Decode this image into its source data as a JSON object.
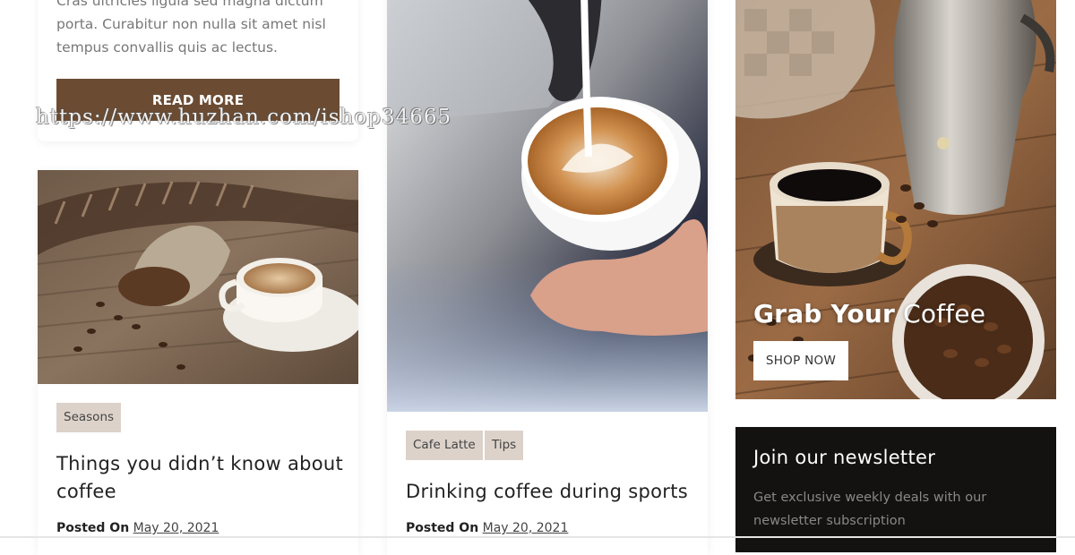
{
  "top_card": {
    "excerpt": "Cras ultricies ligula sed magna dictum porta. Curabitur non nulla sit amet nisl tempus convallis quis ac lectus.",
    "read_more_label": "READ MORE"
  },
  "post_left": {
    "image_alt": "Coffee cup with burlap sack of beans",
    "tags": [
      "Seasons"
    ],
    "title": "Things you didn’t know about coffee",
    "posted_label": "Posted On",
    "date": "May 20, 2021"
  },
  "post_middle": {
    "image_alt": "Barista pouring latte art",
    "tags": [
      "Cafe Latte",
      "Tips"
    ],
    "title": "Drinking coffee during sports",
    "posted_label": "Posted On",
    "date": "May 20, 2021"
  },
  "promo": {
    "title_bold": "Grab Your",
    "title_light": "Coffee",
    "button_label": "SHOP NOW"
  },
  "newsletter": {
    "title": "Join our newsletter",
    "text": "Get exclusive weekly deals with our newsletter subscription"
  },
  "watermark": "https://www.huzhan.com/ishop34665",
  "colors": {
    "accent_brown": "#6b4c33",
    "tag_bg": "#dcd2ca",
    "newsletter_bg": "#141111"
  }
}
